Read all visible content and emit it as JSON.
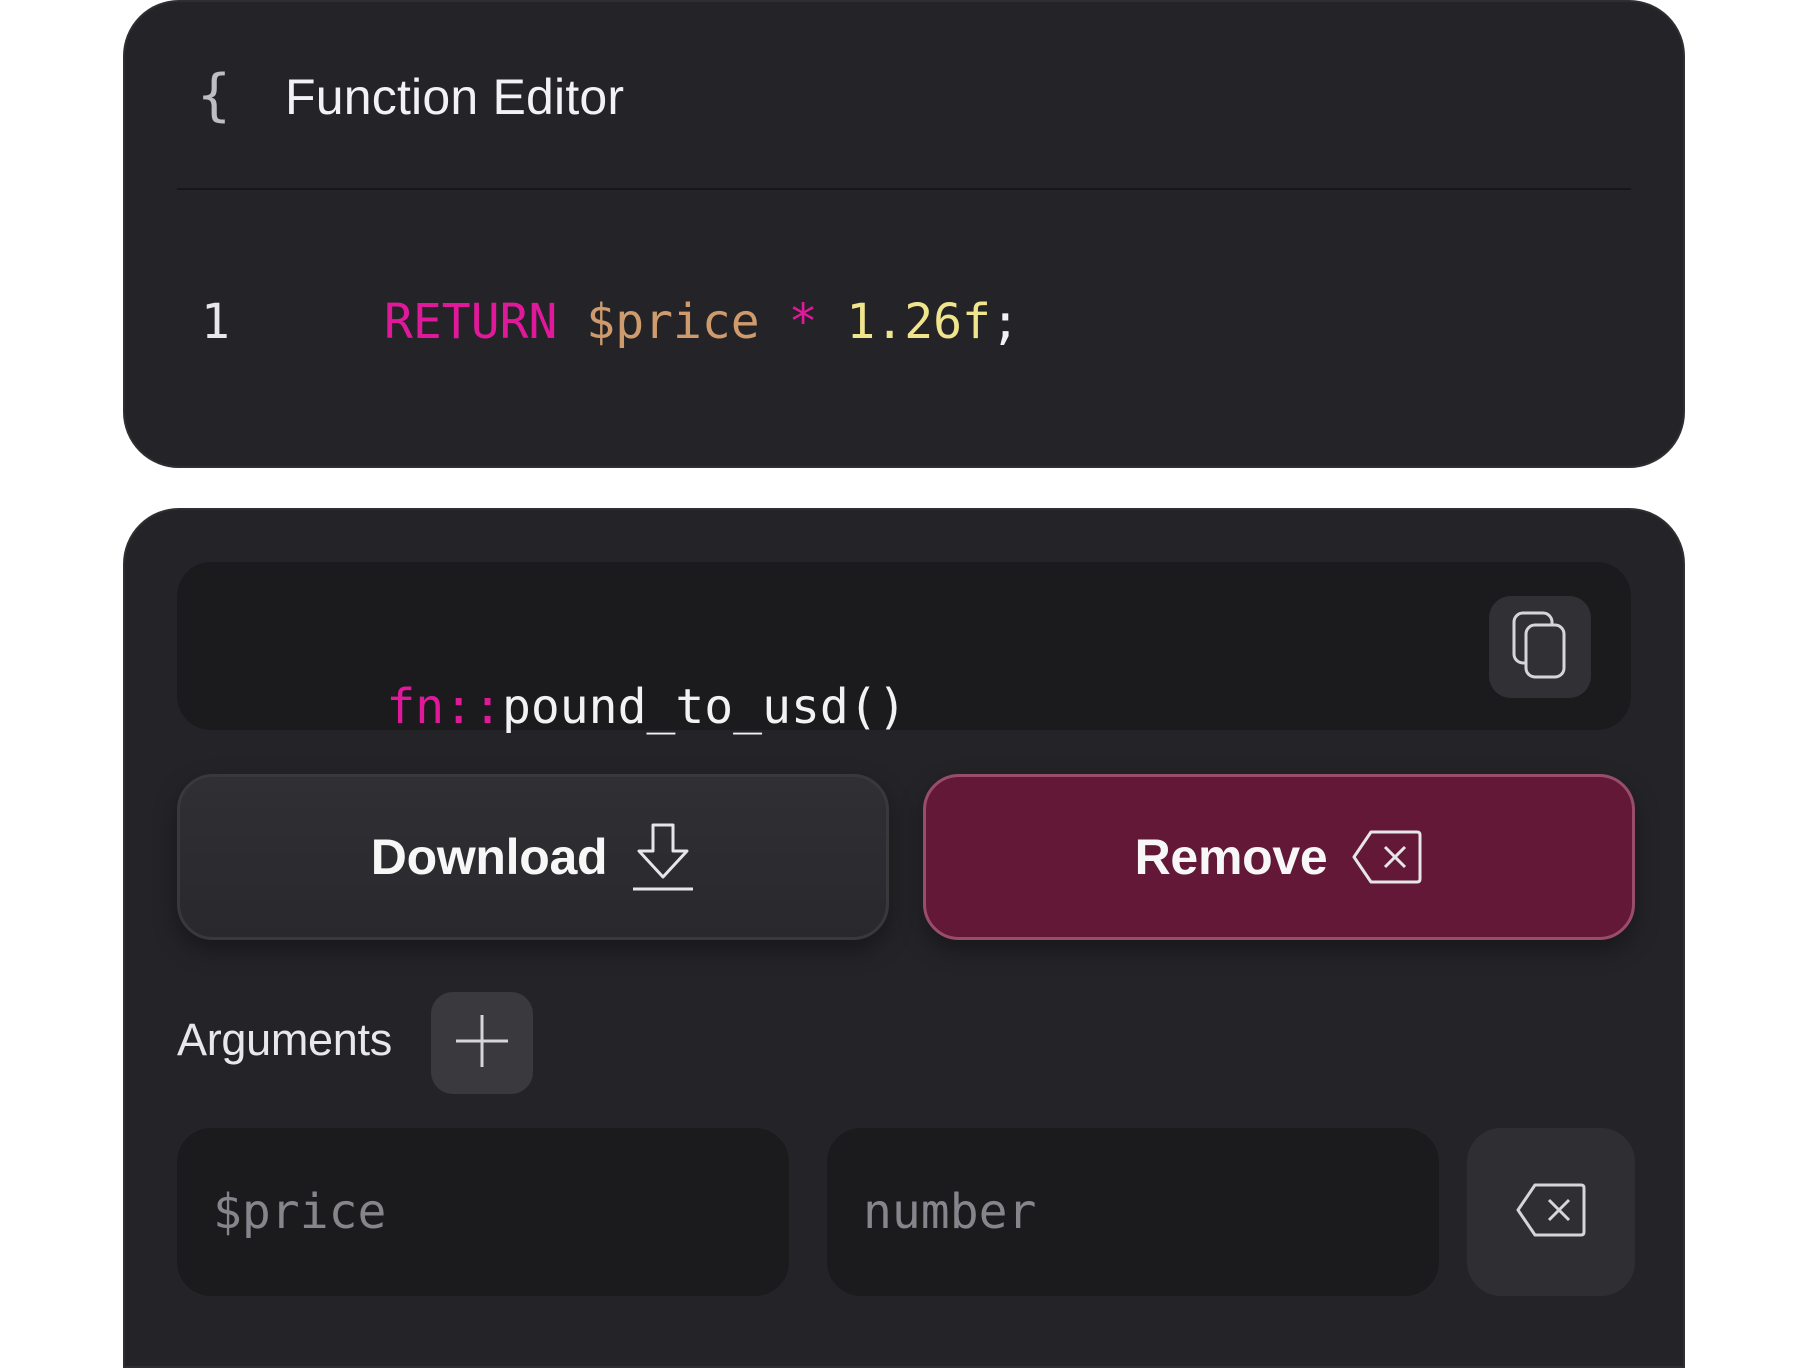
{
  "editor": {
    "title": "Function Editor",
    "icon": "braces-icon",
    "lines": [
      {
        "number": "1",
        "tokens": {
          "keyword": "RETURN",
          "variable": "$price",
          "operator": "*",
          "number": "1.26f",
          "terminator": ";"
        }
      }
    ]
  },
  "function": {
    "signature_prefix": "fn::",
    "signature_name": "pound_to_usd()",
    "copy_icon": "copy-icon",
    "download_label": "Download",
    "download_icon": "download-icon",
    "remove_label": "Remove",
    "remove_icon": "backspace-icon",
    "arguments_label": "Arguments",
    "add_icon": "plus-icon",
    "argument": {
      "name_placeholder": "$price",
      "type_placeholder": "number",
      "delete_icon": "backspace-icon"
    }
  },
  "colors": {
    "panel_bg": "#242428",
    "field_bg": "#1b1b1e",
    "keyword": "#e0199a",
    "variable": "#cf9a6c",
    "number": "#f0e58c",
    "remove_bg": "#631837",
    "remove_border": "#9a4d6b"
  }
}
